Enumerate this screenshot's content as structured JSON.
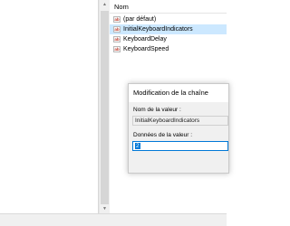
{
  "list": {
    "column_header": "Nom",
    "items": [
      {
        "icon": "string-value-icon",
        "name": "(par défaut)",
        "selected": false
      },
      {
        "icon": "string-value-icon",
        "name": "InitialKeyboardIndicators",
        "selected": true
      },
      {
        "icon": "string-value-icon",
        "name": "KeyboardDelay",
        "selected": false
      },
      {
        "icon": "string-value-icon",
        "name": "KeyboardSpeed",
        "selected": false
      }
    ]
  },
  "dialog": {
    "title": "Modification de la chaîne",
    "name_label": "Nom de la valeur :",
    "name_value": "InitialKeyboardIndicators",
    "data_label": "Données de la valeur :",
    "data_value": "2"
  },
  "colors": {
    "selection": "#cce8ff",
    "focus_border": "#0078d7"
  }
}
